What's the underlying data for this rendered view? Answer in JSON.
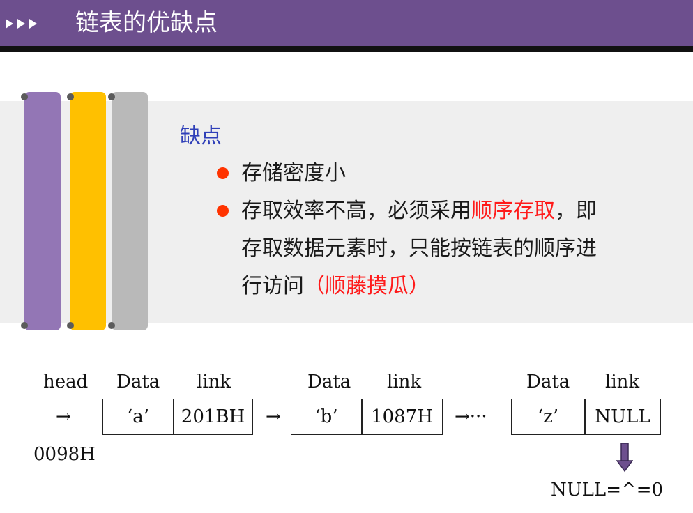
{
  "header": {
    "title": "链表的优缺点"
  },
  "content": {
    "subheading": "缺点",
    "bullets": [
      {
        "lines": [
          "存储密度小"
        ]
      },
      {
        "line1_before": "存取效率不高，必须采用",
        "line1_red": "顺序存取",
        "line1_after": "，即",
        "line2": "存取数据元素时，只能按链表的顺序进",
        "line3_before": "行访问",
        "line3_red": "（顺藤摸瓜）"
      }
    ]
  },
  "diagram": {
    "head_label": "head",
    "head_arrow": "→",
    "head_addr": "0098H",
    "nodes": [
      {
        "data_header": "Data",
        "link_header": "link",
        "data": "‘a’",
        "link": "201BH"
      },
      {
        "data_header": "Data",
        "link_header": "link",
        "data": "‘b’",
        "link": "1087H"
      },
      {
        "data_header": "Data",
        "link_header": "link",
        "data": "‘z’",
        "link": "NULL"
      }
    ],
    "arrow_between": "→",
    "arrow_ellipsis": "→···",
    "null_note": "NULL=^=0"
  },
  "colors": {
    "header": "#6d4f8e",
    "purple_bar": "#9376b5",
    "yellow_bar": "#ffc000",
    "gray_bar": "#b9b9b9",
    "subheading": "#2f3fb8",
    "bullet": "#ff3300",
    "highlight": "#ff1a1a"
  }
}
